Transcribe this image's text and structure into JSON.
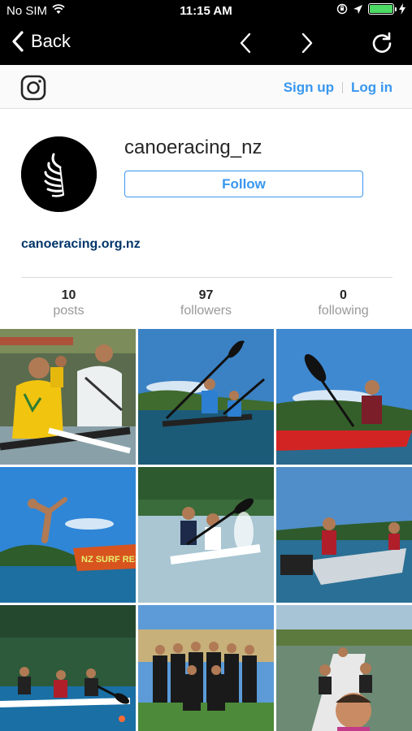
{
  "status_bar": {
    "carrier": "No SIM",
    "time": "11:15 AM"
  },
  "browser_nav": {
    "back_label": "Back"
  },
  "ig_header": {
    "sign_up": "Sign up",
    "log_in": "Log in"
  },
  "profile": {
    "username": "canoeracing_nz",
    "follow_label": "Follow",
    "website": "canoeracing.org.nz",
    "stats": [
      {
        "count": "10",
        "label": "posts"
      },
      {
        "count": "97",
        "label": "followers"
      },
      {
        "count": "0",
        "label": "following"
      }
    ]
  },
  "grid": {
    "photos": [
      {
        "kind": "team-kayakers-close"
      },
      {
        "kind": "k2-paddling"
      },
      {
        "kind": "red-kayak"
      },
      {
        "kind": "diving-jump"
      },
      {
        "kind": "k2-splash"
      },
      {
        "kind": "motor-boat"
      },
      {
        "kind": "k4-race"
      },
      {
        "kind": "team-group-photo"
      },
      {
        "kind": "selfie-k4"
      }
    ],
    "boat_text": "NZ SURF RESCUE"
  }
}
